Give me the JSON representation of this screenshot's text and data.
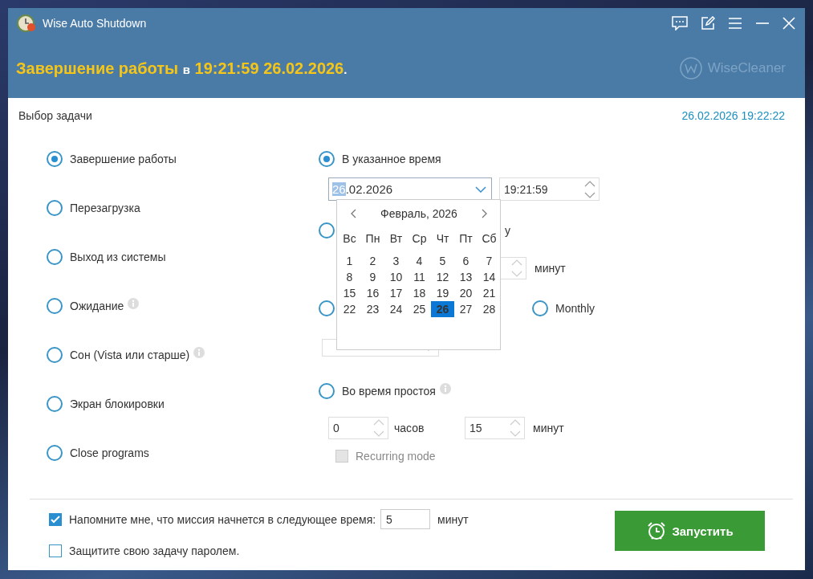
{
  "window": {
    "title": "Wise Auto Shutdown"
  },
  "banner": {
    "action": "Завершение работы",
    "connector": "в",
    "time": "19:21:59 26.02.2026",
    "end": ".",
    "brand": "WiseCleaner"
  },
  "section_title": "Выбор задачи",
  "current_time": "26.02.2026 19:22:22",
  "tasks": [
    {
      "label": "Завершение работы",
      "selected": true,
      "info": false
    },
    {
      "label": "Перезагрузка",
      "selected": false,
      "info": false
    },
    {
      "label": "Выход из системы",
      "selected": false,
      "info": false
    },
    {
      "label": "Ожидание",
      "selected": false,
      "info": true
    },
    {
      "label": "Сон (Vista или старше)",
      "selected": false,
      "info": true
    },
    {
      "label": "Экран блокировки",
      "selected": false,
      "info": false
    },
    {
      "label": "Close programs",
      "selected": false,
      "info": false
    }
  ],
  "schedule": [
    {
      "kind": "datetime",
      "label": "В указанное время",
      "selected": true,
      "date_highlight": "26",
      "date_rest": ".02.2026",
      "time": "19:21:59"
    },
    {
      "kind": "countdown",
      "label": "у",
      "selected": false,
      "unit": "минут"
    },
    {
      "kind": "periodic",
      "selected": false,
      "monthly": {
        "label": "Monthly",
        "selected": false
      }
    },
    {
      "kind": "idle",
      "label": "Во время простоя",
      "selected": false,
      "info": true,
      "hours": "0",
      "hours_unit": "часов",
      "minutes": "15",
      "minutes_unit": "минут",
      "recurring": {
        "label": "Recurring mode",
        "checked": false,
        "disabled": true
      }
    }
  ],
  "calendar": {
    "month": "Февраль, 2026",
    "weekdays": [
      "Вс",
      "Пн",
      "Вт",
      "Ср",
      "Чт",
      "Пт",
      "Сб"
    ],
    "days": [
      {
        "day": "1",
        "selected": false
      },
      {
        "day": "2",
        "selected": false
      },
      {
        "day": "3",
        "selected": false
      },
      {
        "day": "4",
        "selected": false
      },
      {
        "day": "5",
        "selected": false
      },
      {
        "day": "6",
        "selected": false
      },
      {
        "day": "7",
        "selected": false
      },
      {
        "day": "8",
        "selected": false
      },
      {
        "day": "9",
        "selected": false
      },
      {
        "day": "10",
        "selected": false
      },
      {
        "day": "11",
        "selected": false
      },
      {
        "day": "12",
        "selected": false
      },
      {
        "day": "13",
        "selected": false
      },
      {
        "day": "14",
        "selected": false
      },
      {
        "day": "15",
        "selected": false
      },
      {
        "day": "16",
        "selected": false
      },
      {
        "day": "17",
        "selected": false
      },
      {
        "day": "18",
        "selected": false
      },
      {
        "day": "19",
        "selected": false
      },
      {
        "day": "20",
        "selected": false
      },
      {
        "day": "21",
        "selected": false
      },
      {
        "day": "22",
        "selected": false
      },
      {
        "day": "23",
        "selected": false
      },
      {
        "day": "24",
        "selected": false
      },
      {
        "day": "25",
        "selected": false
      },
      {
        "day": "26",
        "selected": true
      },
      {
        "day": "27",
        "selected": false
      },
      {
        "day": "28",
        "selected": false
      }
    ]
  },
  "reminder": {
    "checked": true,
    "label": "Напомните мне, что миссия начнется в следующее время:",
    "value": "5",
    "unit": "минут"
  },
  "password": {
    "checked": false,
    "label": "Защитите свою задачу паролем."
  },
  "start_button": "Запустить"
}
